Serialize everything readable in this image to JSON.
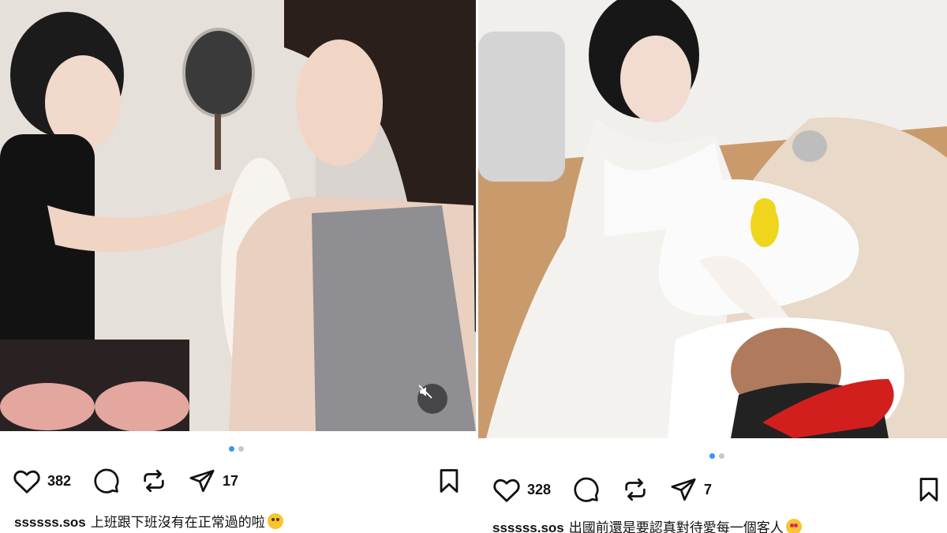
{
  "posts": [
    {
      "id": "left",
      "username": "ssssss.sos",
      "caption_text": "上班跟下班沒有在正常過的啦",
      "caption_emoji": "rolling-on-floor-laughing-emoji",
      "likes": "382",
      "shares": "17",
      "carousel": {
        "total": 2,
        "active": 1
      },
      "media_muted_icon": "speaker-muted-icon"
    },
    {
      "id": "right",
      "username": "ssssss.sos",
      "caption_text": "出國前還是要認真對待愛每一個客人",
      "caption_emoji": "heart-eyes-emoji",
      "likes": "328",
      "shares": "7",
      "carousel": {
        "total": 2,
        "active": 1
      }
    }
  ],
  "icons": {
    "like": "heart-icon",
    "comment": "comment-bubble-icon",
    "repost": "repost-icon",
    "share": "paper-plane-icon",
    "save": "bookmark-icon"
  },
  "colors": {
    "carousel_active_dot": "#3797f0",
    "carousel_inactive_dot": "#c8c8c8",
    "text": "#111111"
  }
}
